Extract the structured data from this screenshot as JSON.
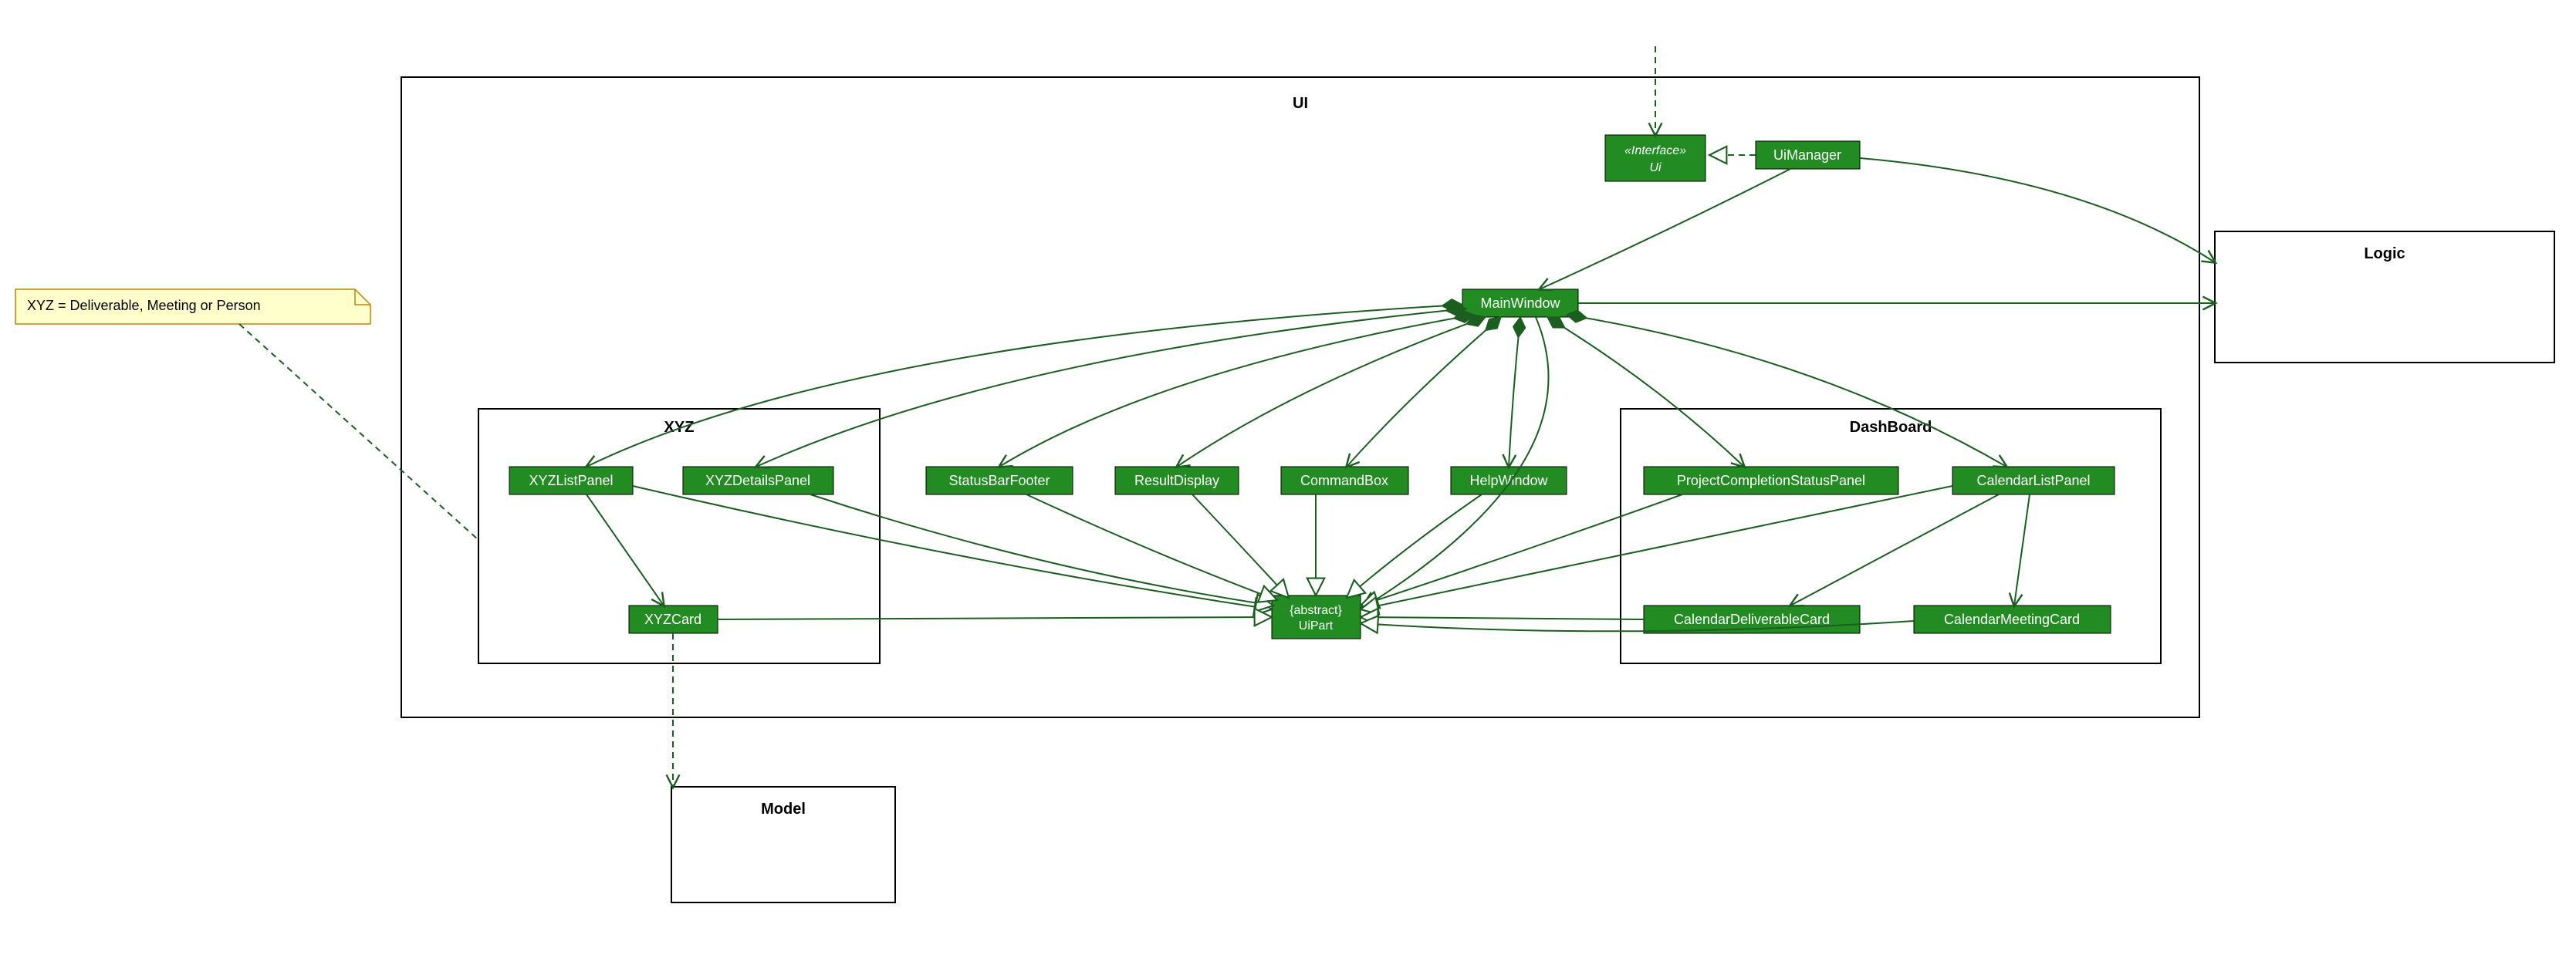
{
  "diagram": {
    "note": "XYZ = Deliverable, Meeting or Person",
    "packages": {
      "ui": "UI",
      "xyz": "XYZ",
      "dashboard": "DashBoard",
      "logic": "Logic",
      "model": "Model"
    },
    "classes": {
      "ui_interface_stereo": "«Interface»",
      "ui_interface_name": "Ui",
      "ui_manager": "UiManager",
      "main_window": "MainWindow",
      "xyz_list_panel": "XYZListPanel",
      "xyz_details_panel": "XYZDetailsPanel",
      "xyz_card": "XYZCard",
      "status_bar_footer": "StatusBarFooter",
      "result_display": "ResultDisplay",
      "command_box": "CommandBox",
      "help_window": "HelpWindow",
      "proj_comp_panel": "ProjectCompletionStatusPanel",
      "calendar_list_panel": "CalendarListPanel",
      "calendar_deliverable_card": "CalendarDeliverableCard",
      "calendar_meeting_card": "CalendarMeetingCard",
      "uipart_abstract": "{abstract}",
      "uipart_name": "UiPart"
    },
    "relationships": [
      {
        "from": "UiManager",
        "to": "Ui",
        "kind": "realization"
      },
      {
        "from": "external",
        "to": "Ui",
        "kind": "dependency"
      },
      {
        "from": "UiManager",
        "to": "MainWindow",
        "kind": "association"
      },
      {
        "from": "UiManager",
        "to": "Logic",
        "kind": "association"
      },
      {
        "from": "MainWindow",
        "to": "Logic",
        "kind": "association"
      },
      {
        "from": "MainWindow",
        "to": "XYZListPanel",
        "kind": "composition"
      },
      {
        "from": "MainWindow",
        "to": "XYZDetailsPanel",
        "kind": "composition"
      },
      {
        "from": "MainWindow",
        "to": "StatusBarFooter",
        "kind": "composition"
      },
      {
        "from": "MainWindow",
        "to": "ResultDisplay",
        "kind": "composition"
      },
      {
        "from": "MainWindow",
        "to": "CommandBox",
        "kind": "composition"
      },
      {
        "from": "MainWindow",
        "to": "HelpWindow",
        "kind": "composition"
      },
      {
        "from": "MainWindow",
        "to": "ProjectCompletionStatusPanel",
        "kind": "composition"
      },
      {
        "from": "MainWindow",
        "to": "CalendarListPanel",
        "kind": "composition"
      },
      {
        "from": "XYZListPanel",
        "to": "XYZCard",
        "kind": "association"
      },
      {
        "from": "CalendarListPanel",
        "to": "CalendarDeliverableCard",
        "kind": "association"
      },
      {
        "from": "CalendarListPanel",
        "to": "CalendarMeetingCard",
        "kind": "association"
      },
      {
        "from": "XYZListPanel",
        "to": "UiPart",
        "kind": "generalization"
      },
      {
        "from": "XYZDetailsPanel",
        "to": "UiPart",
        "kind": "generalization"
      },
      {
        "from": "XYZCard",
        "to": "UiPart",
        "kind": "generalization"
      },
      {
        "from": "StatusBarFooter",
        "to": "UiPart",
        "kind": "generalization"
      },
      {
        "from": "ResultDisplay",
        "to": "UiPart",
        "kind": "generalization"
      },
      {
        "from": "CommandBox",
        "to": "UiPart",
        "kind": "generalization"
      },
      {
        "from": "HelpWindow",
        "to": "UiPart",
        "kind": "generalization"
      },
      {
        "from": "MainWindow",
        "to": "UiPart",
        "kind": "generalization"
      },
      {
        "from": "ProjectCompletionStatusPanel",
        "to": "UiPart",
        "kind": "generalization"
      },
      {
        "from": "CalendarListPanel",
        "to": "UiPart",
        "kind": "generalization"
      },
      {
        "from": "CalendarDeliverableCard",
        "to": "UiPart",
        "kind": "generalization"
      },
      {
        "from": "CalendarMeetingCard",
        "to": "UiPart",
        "kind": "generalization"
      },
      {
        "from": "XYZCard",
        "to": "Model",
        "kind": "dependency"
      },
      {
        "from": "note",
        "to": "XYZ",
        "kind": "note-anchor"
      }
    ]
  }
}
